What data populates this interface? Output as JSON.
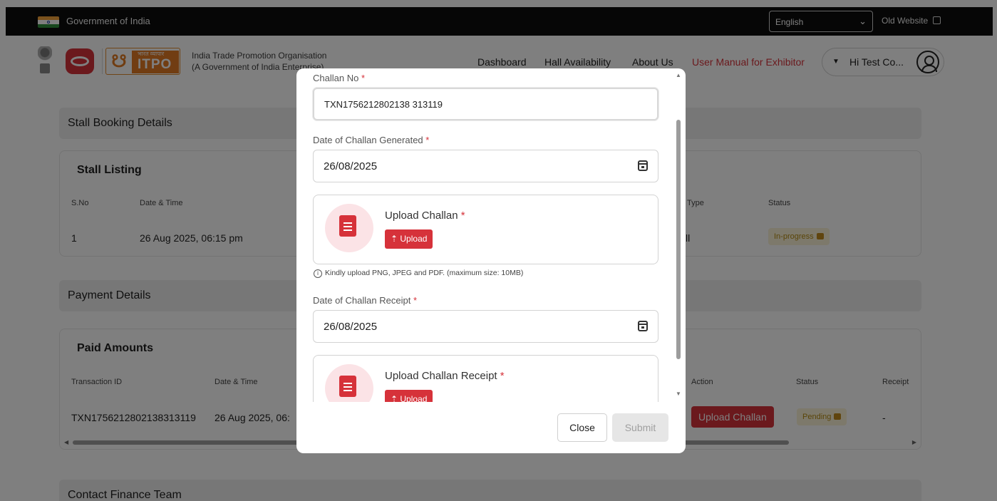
{
  "topbar": {
    "gov_text": "Government of India",
    "language": "English",
    "old_website": "Old Website"
  },
  "header": {
    "logo_hindi": "भारत व्यापार",
    "logo_text": "ITPO",
    "org_name": "India Trade Promotion Organisation",
    "org_sub": "(A Government of India Enterprise)",
    "nav": [
      "Dashboard",
      "Hall Availability",
      "About Us",
      "User Manual for Exhibitor"
    ],
    "user_name": "Hi Test Co..."
  },
  "stall_section": {
    "heading": "Stall Booking Details",
    "card_title": "Stall Listing",
    "columns": [
      "S.No",
      "Date & Time",
      "Type",
      "Status"
    ],
    "rows": [
      {
        "sno": "1",
        "datetime": "26 Aug 2025, 06:15 pm",
        "type": "ll",
        "status": "In-progress"
      }
    ]
  },
  "payment_section": {
    "heading": "Payment Details",
    "card_title": "Paid Amounts",
    "columns": [
      "Transaction ID",
      "Date & Time",
      "Action",
      "Status",
      "Receipt"
    ],
    "rows": [
      {
        "txn": "TXN1756212802138313119",
        "datetime": "26 Aug 2025, 06:",
        "action": "Upload Challan",
        "status": "Pending",
        "receipt": "-"
      }
    ]
  },
  "contact_section": {
    "heading": "Contact Finance Team"
  },
  "modal": {
    "challan_no_label": "Challan No",
    "challan_no_value": "TXN1756212802138 313119",
    "challan_date_label": "Date of Challan Generated",
    "challan_date_value": "26/08/2025",
    "upload_challan_title": "Upload Challan",
    "upload_label": "Upload",
    "hint": "Kindly upload PNG, JPEG and PDF. (maximum size: 10MB)",
    "receipt_date_label": "Date of Challan Receipt",
    "receipt_date_value": "26/08/2025",
    "upload_receipt_title": "Upload Challan Receipt",
    "close_label": "Close",
    "submit_label": "Submit"
  },
  "colors": {
    "accent": "#d6323a",
    "pending_bg": "#fbf3d6"
  }
}
